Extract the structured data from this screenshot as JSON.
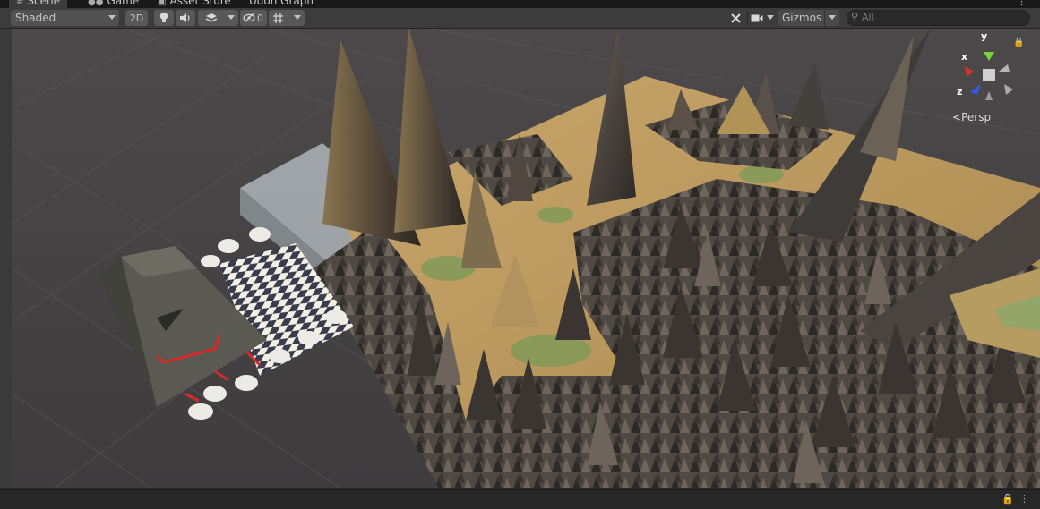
{
  "tabs": [
    {
      "label": "Scene",
      "icon": "hash-icon",
      "active": true
    },
    {
      "label": "Game",
      "icon": "gamepad-icon",
      "active": false
    },
    {
      "label": "Asset Store",
      "icon": "store-icon",
      "active": false
    },
    {
      "label": "Udon Graph",
      "icon": "graph-icon",
      "active": false
    }
  ],
  "toolbar": {
    "shading_mode": "Shaded",
    "mode_2d_label": "2D",
    "hidden_count": "0",
    "gizmos_label": "Gizmos",
    "search_placeholder": "All"
  },
  "orientation_gizmo": {
    "x_label": "x",
    "y_label": "y",
    "z_label": "z",
    "projection_label": "Persp"
  },
  "colors": {
    "toolbar_bg": "#3c3c3c",
    "tabbar_bg": "#191919",
    "viewport_bg": "#4a4648",
    "axis_x": "#d8342b",
    "axis_y": "#7bd23c",
    "axis_z": "#3359e0"
  },
  "icons": [
    "hash-icon",
    "gamepad-icon",
    "store-icon",
    "graph-icon",
    "lightbulb-icon",
    "speaker-icon",
    "layers-icon",
    "eye-hidden-icon",
    "grid-icon",
    "tools-icon",
    "camera-icon",
    "search-icon",
    "lock-icon",
    "kebab-menu-icon"
  ]
}
